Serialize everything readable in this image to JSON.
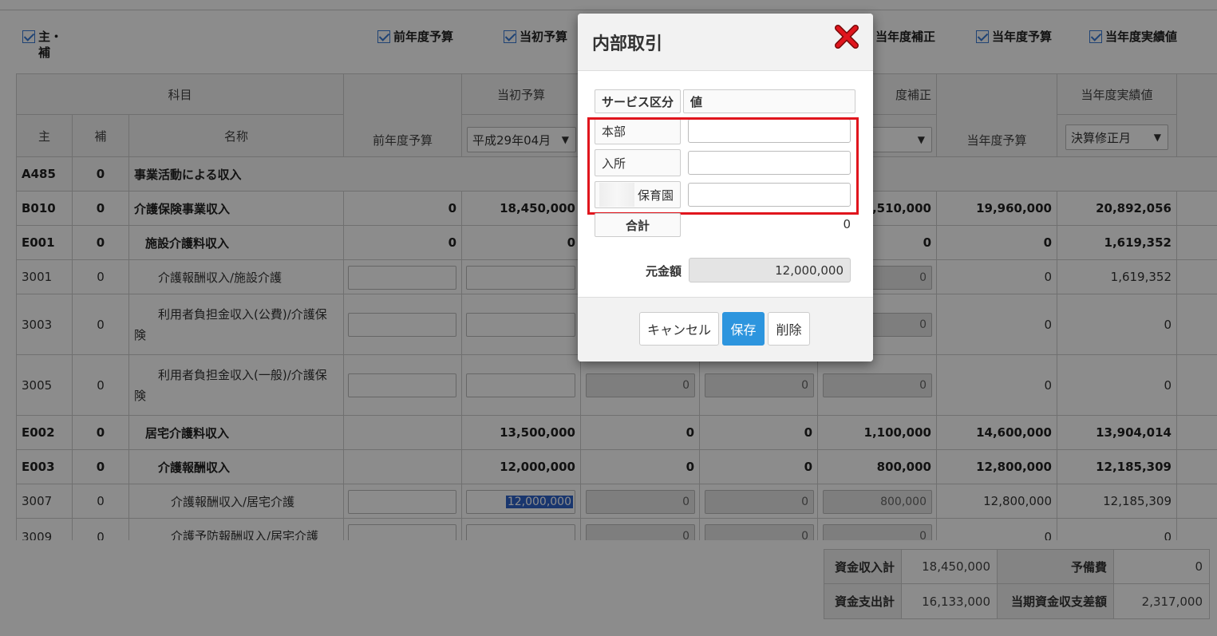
{
  "filters": {
    "main_sub": "主・補",
    "prev_year_budget": "前年度予算",
    "initial_budget": "当初予算",
    "current_revision": "当年度補正",
    "current_budget": "当年度予算",
    "current_actual": "当年度実績値"
  },
  "grid": {
    "headers": {
      "subject": "科目",
      "main": "主",
      "sub": "補",
      "name": "名称",
      "prev_year_budget": "前年度予算",
      "initial_budget": "当初予算",
      "revision_partial": "度補正",
      "current_budget": "当年度予算",
      "current_actual": "当年度実績値"
    },
    "dropdowns": {
      "initial_budget_period": "平成29年04月",
      "actual_period": "決算修正月"
    },
    "rows": [
      {
        "code": "A485",
        "sub": "0",
        "name": "事業活動による収入"
      },
      {
        "code": "B010",
        "sub": "0",
        "name": "介護保険事業収入",
        "prev": "0",
        "initial": "18,450,000",
        "revision": ",510,000",
        "budget": "19,960,000",
        "actual": "20,892,056"
      },
      {
        "code": "E001",
        "sub": "0",
        "name": "施設介護料収入",
        "prev": "0",
        "initial": "0",
        "revision": "0",
        "budget": "0",
        "actual": "1,619,352"
      },
      {
        "code": "3001",
        "sub": "0",
        "name": "介護報酬収入/施設介護",
        "revision": "0",
        "budget": "0",
        "actual": "1,619,352"
      },
      {
        "code": "3003",
        "sub": "0",
        "name": "利用者負担金収入(公費)/介護保険",
        "revision": "0",
        "budget": "0",
        "actual": "0"
      },
      {
        "code": "3005",
        "sub": "0",
        "name": "利用者負担金収入(一般)/介護保険",
        "c1": "0",
        "c2": "0",
        "revision": "0",
        "budget": "0",
        "actual": "0"
      },
      {
        "code": "E002",
        "sub": "0",
        "name": "居宅介護料収入",
        "initial": "13,500,000",
        "c1": "0",
        "c2": "0",
        "revision": "1,100,000",
        "budget": "14,600,000",
        "actual": "13,904,014"
      },
      {
        "code": "E003",
        "sub": "0",
        "name": "介護報酬収入",
        "initial": "12,000,000",
        "c1": "0",
        "c2": "0",
        "revision": "800,000",
        "budget": "12,800,000",
        "actual": "12,185,309"
      },
      {
        "code": "3007",
        "sub": "0",
        "name": "介護報酬収入/居宅介護",
        "initial": "12,000,000",
        "c1": "0",
        "c2": "0",
        "revision": "800,000",
        "budget": "12,800,000",
        "actual": "12,185,309"
      },
      {
        "code": "3009",
        "sub": "0",
        "name": "介護予防報酬収入/居宅介護",
        "c1": "0",
        "c2": "0",
        "revision": "0",
        "budget": "0",
        "actual": "0"
      }
    ]
  },
  "totals": {
    "fund_income_label": "資金収入計",
    "fund_income_value": "18,450,000",
    "reserve_label": "予備費",
    "reserve_value": "0",
    "fund_expense_label": "資金支出計",
    "fund_expense_value": "16,133,000",
    "balance_label": "当期資金収支差額",
    "balance_value": "2,317,000"
  },
  "modal": {
    "title": "内部取引",
    "service_label": "サービス区分",
    "value_label": "値",
    "rows": [
      {
        "label": "本部"
      },
      {
        "label": "入所"
      },
      {
        "label": "保育園"
      }
    ],
    "total_label": "合計",
    "total_value": "0",
    "base_amount_label": "元金額",
    "base_amount_value": "12,000,000",
    "cancel": "キャンセル",
    "save": "保存",
    "delete": "削除"
  },
  "colors": {
    "accent": "#2d95de",
    "highlight": "#e0151d",
    "close": "#e0151d"
  }
}
